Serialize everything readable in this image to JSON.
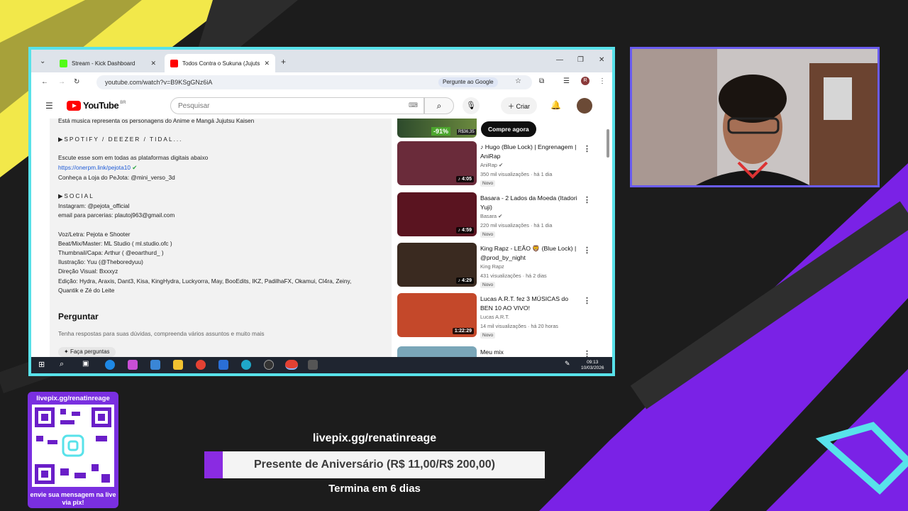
{
  "browser": {
    "tabs": [
      {
        "label": "Stream - Kick Dashboard",
        "favicon_color": "#53fc18"
      },
      {
        "label": "Todos Contra o Sukuna (Jujutsu K",
        "favicon_color": "#ff0000"
      }
    ],
    "url": "youtube.com/watch?v=B9KSgGNz6iA",
    "ask_google": "Pergunte ao Google"
  },
  "youtube": {
    "logo_word": "YouTube",
    "region": "BR",
    "search_placeholder": "Pesquisar",
    "create_label": "Criar",
    "description_lines": [
      "Está musica representa os personagens do Anime e Mangá Jujutsu Kaisen",
      "▶SPOTIFY / DEEZER / TIDAL...",
      "Escute esse som em todas as plataformas digitais abaixo",
      "https://onerpm.link/pejota10",
      "Conheça a Loja do PeJota:  @mini_verso_3d",
      "▶SOCIAL",
      "Instagram: @pejota_official",
      "email para parcerias: plautoj963@gmail.com",
      "Voz/Letra: Pejota e Shooter",
      "Beat/Mix/Master: ML Studio ( ml.studio.ofc )",
      "Thumbnail/Capa: Arthur ( @eoarthurd_ )",
      "Ilustração: Yuu (@Theboredyuu)",
      "Direção Visual: Bxxxyz",
      "Edição: Hydra, Araxis, Dant3, Kisa, KingHydra, Luckyorra, May, BooEdits, IKZ, PadilhaFX, Okamui, Cl4ra, Zeiny,",
      "Quantik e Zé do Leite"
    ],
    "ask_title": "Perguntar",
    "ask_subtitle": "Tenha respostas para suas dúvidas, compreenda vários assuntos e muito mais",
    "ask_button": "Faça perguntas",
    "promo": {
      "discount": "-91%",
      "price": "R$36,35",
      "button": "Compre agora"
    },
    "videos": [
      {
        "title": "♪ Hugo (Blue Lock) | Engrenagem | AniRap",
        "channel": "AniRap",
        "meta": "350 mil visualizações · há 1 dia",
        "badge": "Novo",
        "duration": "4:05",
        "thumb": "#6a2b3a"
      },
      {
        "title": "Basara - 2 Lados da Moeda (Itadori Yuji)",
        "channel": "Basara",
        "meta": "220 mil visualizações · há 1 dia",
        "badge": "Novo",
        "duration": "4:59",
        "thumb": "#5a1420"
      },
      {
        "title": "King Rapz - LEÃO 🦁 (Blue Lock) | @prod_by_night",
        "channel": "King Rapz",
        "meta": "431 visualizações · há 2 dias",
        "badge": "Novo",
        "duration": "4:29",
        "thumb": "#3a2a20"
      },
      {
        "title": "Lucas A.R.T. fez 3 MÚSICAS do BEN 10 AO VIVO!",
        "channel": "Lucas A.R.T.",
        "meta": "14 mil visualizações · há 20 horas",
        "badge": "Novo",
        "duration": "1:22:29",
        "thumb": "#c4482a"
      },
      {
        "title": "Meu mix",
        "channel": "",
        "meta": "",
        "badge": "",
        "duration": "",
        "thumb": "#7aa6b8"
      }
    ]
  },
  "taskbar": {
    "time": "09:13",
    "date": "10/03/2026"
  },
  "overlay": {
    "qr_url": "livepix.gg/renatinreage",
    "qr_note": "envie sua mensagem na live via pix!",
    "goal_url": "livepix.gg/renatinreage",
    "goal_text": "Presente de Aniversário (R$ 11,00/R$ 200,00)",
    "goal_progress": 0.055,
    "goal_end": "Termina em 6 dias"
  },
  "colors": {
    "capture_border": "#58e2ea",
    "webcam_border": "#6a5cf0",
    "accent_purple": "#8a2be2",
    "accent_yellow": "#f2e84a"
  }
}
